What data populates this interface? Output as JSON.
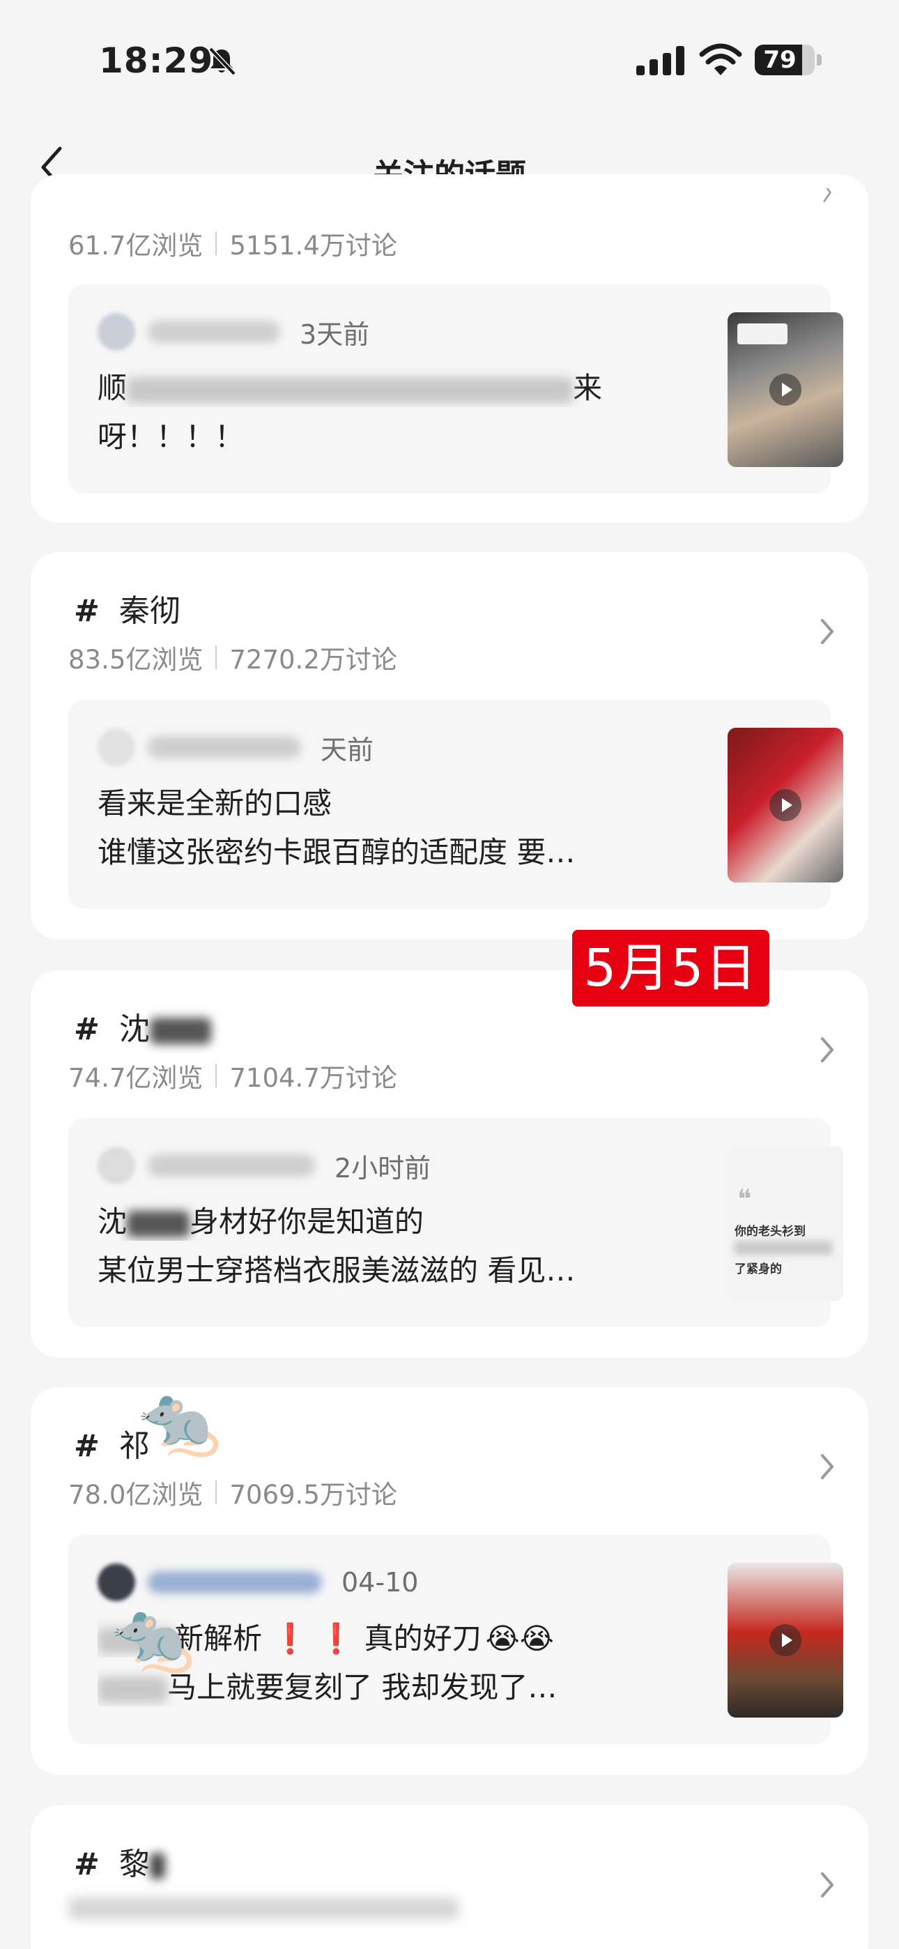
{
  "status_bar": {
    "time": "18:29",
    "battery": "79",
    "battery_level": 0.79
  },
  "nav": {
    "title": "关注的话题"
  },
  "overlay": {
    "date_badge": "5月5日"
  },
  "topics": [
    {
      "name": "",
      "views": "61.7亿浏览",
      "discussions": "5151.4万讨论",
      "post": {
        "time_ago": "3天前",
        "line1": "顺",
        "line1_end": "来",
        "line2": "呀！！！！"
      }
    },
    {
      "name": "秦彻",
      "views": "83.5亿浏览",
      "discussions": "7270.2万讨论",
      "post": {
        "time_ago": "天前",
        "line1": "看来是全新的口感",
        "line2": "谁懂这张密约卡跟百醇的适配度 要…"
      }
    },
    {
      "name": "沈",
      "views": "74.7亿浏览",
      "discussions": "7104.7万讨论",
      "post": {
        "time_ago": "2小时前",
        "line1": "沈",
        "line1_end": "身材好你是知道的",
        "line2": "某位男士穿搭档衣服美滋滋的 看见…",
        "thumb_text_1": "你的老头衫到",
        "thumb_text_2": "了紧身的"
      }
    },
    {
      "name": "祁",
      "views": "78.0亿浏览",
      "discussions": "7069.5万讨论",
      "post": {
        "time_ago": "04-10",
        "line1_end": "新解析",
        "line1_after": "真的好刀",
        "line2_end": "马上就要复刻了 我却发现了…"
      }
    },
    {
      "name": "黎"
    }
  ]
}
